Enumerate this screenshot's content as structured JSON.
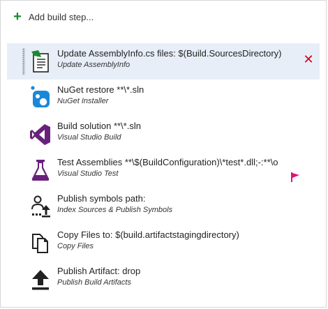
{
  "add_build_step": {
    "label": "Add build step..."
  },
  "steps": [
    {
      "title": "Update AssemblyInfo.cs files: $(Build.SourcesDirectory)",
      "subtitle": "Update AssemblyInfo",
      "icon": "assemblyinfo-icon",
      "selected": true
    },
    {
      "title": "NuGet restore **\\*.sln",
      "subtitle": "NuGet Installer",
      "icon": "nuget-icon"
    },
    {
      "title": "Build solution **\\*.sln",
      "subtitle": "Visual Studio Build",
      "icon": "visual-studio-icon"
    },
    {
      "title": "Test Assemblies **\\$(BuildConfiguration)\\*test*.dll;-:**\\o",
      "subtitle": "Visual Studio Test",
      "icon": "flask-icon"
    },
    {
      "title": "Publish symbols path:",
      "subtitle": "Index Sources & Publish Symbols",
      "icon": "publish-symbols-icon"
    },
    {
      "title": "Copy Files to: $(build.artifactstagingdirectory)",
      "subtitle": "Copy Files",
      "icon": "copy-files-icon"
    },
    {
      "title": "Publish Artifact: drop",
      "subtitle": "Publish Build Artifacts",
      "icon": "upload-arrow-icon"
    }
  ],
  "colors": {
    "accent_green": "#1b8a2e",
    "remove_red": "#d0021b",
    "vs_purple": "#68217a",
    "selected_bg": "#e8eef8"
  }
}
